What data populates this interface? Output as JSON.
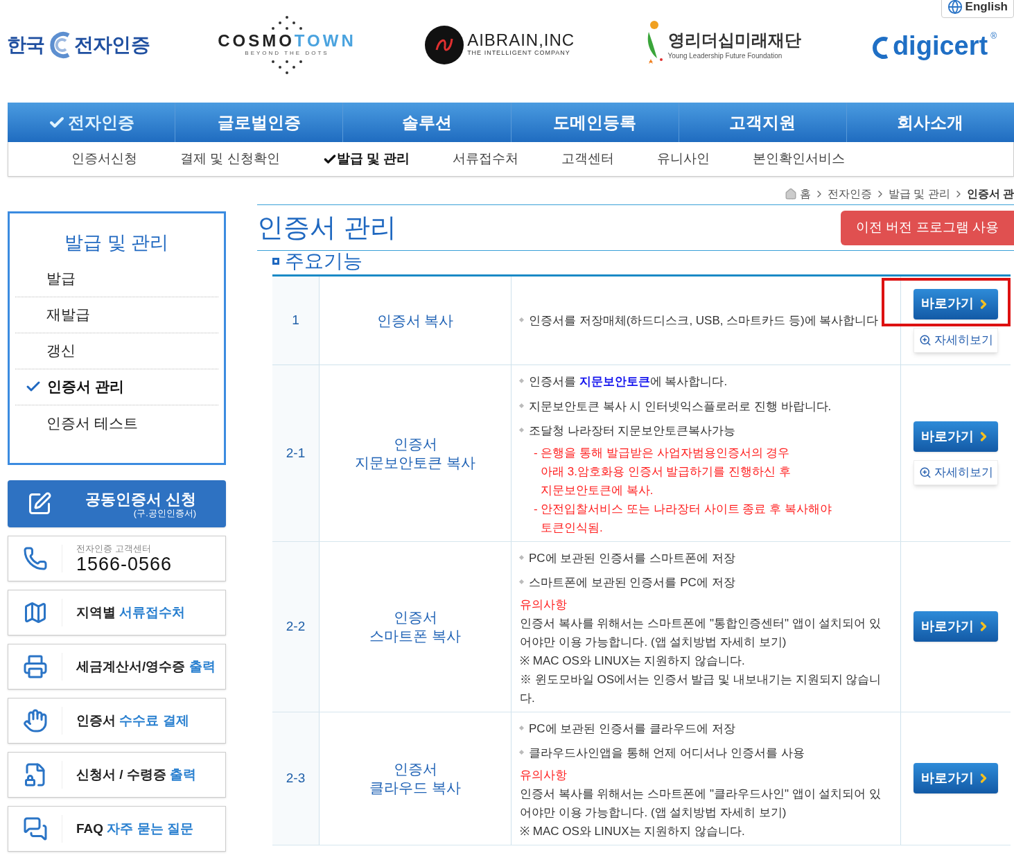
{
  "header": {
    "logos": [
      {
        "kind": "kecert",
        "left": "한국",
        "right": "전자인증"
      },
      {
        "kind": "cosmo",
        "text_a": "COSMO",
        "text_b": "TOWN",
        "tagline": "BEYOND THE DOTS"
      },
      {
        "kind": "aibrain",
        "text": "AIBRAIN,INC",
        "tagline": "THE INTELLIGENT COMPANY"
      },
      {
        "kind": "foundation",
        "text": "영리더십미래재단",
        "tagline": "Young Leadership Future Foundation"
      },
      {
        "kind": "digicert",
        "text": "digicert",
        "mark": "®"
      }
    ],
    "language_button": "English"
  },
  "main_nav": [
    {
      "label": "전자인증",
      "selected": true
    },
    {
      "label": "글로벌인증",
      "selected": false
    },
    {
      "label": "솔루션",
      "selected": false
    },
    {
      "label": "도메인등록",
      "selected": false
    },
    {
      "label": "고객지원",
      "selected": false
    },
    {
      "label": "회사소개",
      "selected": false
    }
  ],
  "sub_nav": [
    {
      "label": "인증서신청",
      "selected": false
    },
    {
      "label": "결제 및 신청확인",
      "selected": false
    },
    {
      "label": "발급 및 관리",
      "selected": true
    },
    {
      "label": "서류접수처",
      "selected": false
    },
    {
      "label": "고객센터",
      "selected": false
    },
    {
      "label": "유니사인",
      "selected": false
    },
    {
      "label": "본인확인서비스",
      "selected": false
    }
  ],
  "breadcrumb": [
    "홈",
    "전자인증",
    "발급 및 관리",
    "인증서 관"
  ],
  "sidebar": {
    "title": "발급 및 관리",
    "items": [
      {
        "label": "발급",
        "selected": false
      },
      {
        "label": "재발급",
        "selected": false
      },
      {
        "label": "갱신",
        "selected": false
      },
      {
        "label": "인증서 관리",
        "selected": true
      },
      {
        "label": "인증서 테스트",
        "selected": false
      }
    ]
  },
  "quick_links": [
    {
      "kind": "primary",
      "title": "공동인증서 신청",
      "subtitle": "(구.공인인증서)"
    },
    {
      "kind": "phone",
      "label": "전자인증 고객센터",
      "number": "1566-0566"
    },
    {
      "kind": "link",
      "text": "지역별",
      "accent": "서류접수처"
    },
    {
      "kind": "link",
      "text": "세금계산서/영수증",
      "accent": "출력"
    },
    {
      "kind": "link",
      "text": "인증서",
      "accent": "수수료 결제"
    },
    {
      "kind": "link",
      "text": "신청서 / 수령증",
      "accent": "출력"
    },
    {
      "kind": "link",
      "text": "FAQ",
      "accent": "자주 묻는 질문"
    }
  ],
  "content": {
    "title": "인증서 관리",
    "legacy_button": "이전 버전 프로그램 사용",
    "section_title": "주요기능",
    "rows": [
      {
        "no": "1",
        "name": [
          "인증서 복사"
        ],
        "highlighted": true,
        "go_button": "바로가기",
        "detail_button": "자세히보기",
        "lines": [
          {
            "kind": "bullet",
            "text": "인증서를 저장매체(하드디스크, USB, 스마트카드 등)에 복사합니다"
          }
        ]
      },
      {
        "no": "2-1",
        "name": [
          "인증서",
          "지문보안토큰 복사"
        ],
        "highlighted": false,
        "go_button": "바로가기",
        "detail_button": "자세히보기",
        "lines": [
          {
            "kind": "bullet",
            "text": "인증서를 **지문보안토큰**에 복사합니다."
          },
          {
            "kind": "bullet",
            "text": "지문보안토큰 복사 시 인터넷익스플로러로 진행 바랍니다."
          },
          {
            "kind": "bullet",
            "text": "조달청 나라장터 지문보안토큰복사가능"
          },
          {
            "kind": "note",
            "parts": [
              "- 은행을 통해 발급받은 사업자범용인증서의 경우",
              "아래 3.암호화용 인증서 발급하기를 진행하신 후",
              "지문보안토큰에 복사."
            ]
          },
          {
            "kind": "note",
            "parts": [
              "- 안전입찰서비스 또는 나라장터 사이트 종료 후 복사해야",
              "토큰인식됨."
            ]
          }
        ]
      },
      {
        "no": "2-2",
        "name": [
          "인증서",
          "스마트폰 복사"
        ],
        "highlighted": false,
        "go_button": "바로가기",
        "lines": [
          {
            "kind": "bullet",
            "text": "PC에 보관된 인증서를 스마트폰에 저장"
          },
          {
            "kind": "bullet",
            "text": "스마트폰에 보관된 인증서를 PC에 저장"
          },
          {
            "kind": "warning",
            "text": "유의사항"
          },
          {
            "kind": "text",
            "text": "인증서 복사를 위해서는 스마트폰에 \"통합인증센터\" 앱이 설치되어 있어야만 이용 가능합니다. (앱 설치방법 자세히 보기)"
          },
          {
            "kind": "text",
            "text": "※ MAC OS와 LINUX는 지원하지 않습니다."
          },
          {
            "kind": "text",
            "text": "※ 윈도모바일 OS에서는 인증서 발급 및 내보내기는 지원되지 않습니다."
          }
        ]
      },
      {
        "no": "2-3",
        "name": [
          "인증서",
          "클라우드 복사"
        ],
        "highlighted": false,
        "go_button": "바로가기",
        "lines": [
          {
            "kind": "bullet",
            "text": "PC에 보관된 인증서를 클라우드에 저장"
          },
          {
            "kind": "bullet",
            "text": "클라우드사인앱을 통해 언제 어디서나 인증서를 사용"
          },
          {
            "kind": "warning",
            "text": "유의사항"
          },
          {
            "kind": "text",
            "text": "인증서 복사를 위해서는 스마트폰에 \"클라우드사인\" 앱이 설치되어 있어야만 이용 가능합니다. (앱 설치방법 자세히 보기)"
          },
          {
            "kind": "text",
            "text": "※ MAC OS와 LINUX는 지원하지 않습니다."
          }
        ]
      }
    ]
  }
}
